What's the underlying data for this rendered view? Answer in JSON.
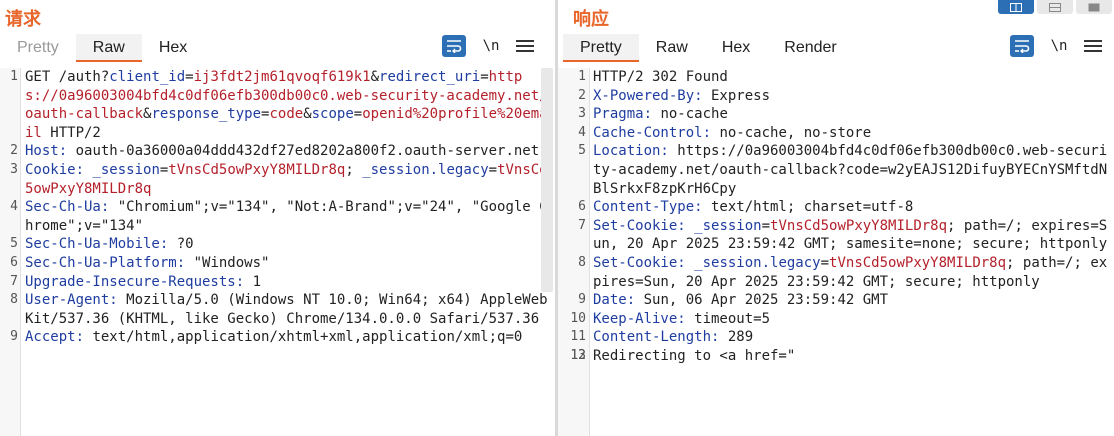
{
  "request": {
    "title": "请求",
    "tabs": [
      {
        "label": "Pretty",
        "state": "dim"
      },
      {
        "label": "Raw",
        "state": "active"
      },
      {
        "label": "Hex",
        "state": ""
      }
    ],
    "tools": {
      "wrap_icon": "word-wrap-icon",
      "newline_label": "\\n",
      "menu_icon": "hamburger-menu-icon"
    },
    "lines": [
      {
        "n": "1",
        "parts": [
          [
            "t",
            "GET /auth?"
          ],
          [
            "k",
            "client_id"
          ],
          [
            "t",
            "="
          ],
          [
            "v",
            "ij3fdt2jm61qvoqf619k1"
          ],
          [
            "t",
            "&"
          ],
          [
            "k",
            "redirect_uri"
          ],
          [
            "t",
            "="
          ],
          [
            "v",
            "https://0a96003004bfd4c0df06efb300db00c0.web-security-academy.net/oauth-callback"
          ],
          [
            "t",
            "&"
          ],
          [
            "k",
            "response_type"
          ],
          [
            "t",
            "="
          ],
          [
            "v",
            "code"
          ],
          [
            "t",
            "&"
          ],
          [
            "k",
            "scope"
          ],
          [
            "t",
            "="
          ],
          [
            "v",
            "openid%20profile%20email"
          ],
          [
            "t",
            " HTTP/2"
          ]
        ]
      },
      {
        "n": "2",
        "parts": [
          [
            "k",
            "Host:"
          ],
          [
            "t",
            " oauth-0a36000a04ddd432df27ed8202a800f2.oauth-server.net"
          ]
        ]
      },
      {
        "n": "3",
        "parts": [
          [
            "k",
            "Cookie:"
          ],
          [
            "t",
            " "
          ],
          [
            "k",
            "_session"
          ],
          [
            "t",
            "="
          ],
          [
            "v",
            "tVnsCd5owPxyY8MILDr8q"
          ],
          [
            "t",
            "; "
          ],
          [
            "k",
            "_session.legacy"
          ],
          [
            "t",
            "="
          ],
          [
            "v",
            "tVnsCd5owPxyY8MILDr8q"
          ]
        ]
      },
      {
        "n": "4",
        "parts": [
          [
            "k",
            "Sec-Ch-Ua:"
          ],
          [
            "t",
            " \"Chromium\";v=\"134\", \"Not:A-Brand\";v=\"24\", \"Google Chrome\";v=\"134\""
          ]
        ]
      },
      {
        "n": "5",
        "parts": [
          [
            "k",
            "Sec-Ch-Ua-Mobile:"
          ],
          [
            "t",
            " ?0"
          ]
        ]
      },
      {
        "n": "6",
        "parts": [
          [
            "k",
            "Sec-Ch-Ua-Platform:"
          ],
          [
            "t",
            " \"Windows\""
          ]
        ]
      },
      {
        "n": "7",
        "parts": [
          [
            "k",
            "Upgrade-Insecure-Requests:"
          ],
          [
            "t",
            " 1"
          ]
        ]
      },
      {
        "n": "8",
        "parts": [
          [
            "k",
            "User-Agent:"
          ],
          [
            "t",
            " Mozilla/5.0 (Windows NT 10.0; Win64; x64) AppleWebKit/537.36 (KHTML, like Gecko) Chrome/134.0.0.0 Safari/537.36"
          ]
        ]
      },
      {
        "n": "9",
        "parts": [
          [
            "k",
            "Accept:"
          ],
          [
            "t",
            " text/html,application/xhtml+xml,application/xml;q=0"
          ]
        ]
      }
    ]
  },
  "response": {
    "title": "响应",
    "tabs": [
      {
        "label": "Pretty",
        "state": "active"
      },
      {
        "label": "Raw",
        "state": ""
      },
      {
        "label": "Hex",
        "state": ""
      },
      {
        "label": "Render",
        "state": ""
      }
    ],
    "tools": {
      "wrap_icon": "word-wrap-icon",
      "newline_label": "\\n",
      "menu_icon": "hamburger-menu-icon"
    },
    "view_toggle_icons": [
      "split-horizontal-icon",
      "split-vertical-icon",
      "single-pane-icon"
    ],
    "lines": [
      {
        "n": "1",
        "parts": [
          [
            "t",
            "HTTP/2 302 Found"
          ]
        ]
      },
      {
        "n": "2",
        "parts": [
          [
            "k",
            "X-Powered-By:"
          ],
          [
            "t",
            " Express"
          ]
        ]
      },
      {
        "n": "3",
        "parts": [
          [
            "k",
            "Pragma:"
          ],
          [
            "t",
            " no-cache"
          ]
        ]
      },
      {
        "n": "4",
        "parts": [
          [
            "k",
            "Cache-Control:"
          ],
          [
            "t",
            " no-cache, no-store"
          ]
        ]
      },
      {
        "n": "5",
        "parts": [
          [
            "k",
            "Location:"
          ],
          [
            "t",
            " https://0a96003004bfd4c0df06efb300db00c0.web-security-academy.net/oauth-callback?code=w2yEAJS12DifuyBYECnYSMftdNBlSrkxF8zpKrH6Cpy"
          ]
        ]
      },
      {
        "n": "6",
        "parts": [
          [
            "k",
            "Content-Type:"
          ],
          [
            "t",
            " text/html; charset=utf-8"
          ]
        ]
      },
      {
        "n": "7",
        "parts": [
          [
            "k",
            "Set-Cookie:"
          ],
          [
            "t",
            " "
          ],
          [
            "k",
            "_session"
          ],
          [
            "t",
            "="
          ],
          [
            "v",
            "tVnsCd5owPxyY8MILDr8q"
          ],
          [
            "t",
            "; path=/; expires=Sun, 20 Apr 2025 23:59:42 GMT; samesite=none; secure; httponly"
          ]
        ]
      },
      {
        "n": "8",
        "parts": [
          [
            "k",
            "Set-Cookie:"
          ],
          [
            "t",
            " "
          ],
          [
            "k",
            "_session.legacy"
          ],
          [
            "t",
            "="
          ],
          [
            "v",
            "tVnsCd5owPxyY8MILDr8q"
          ],
          [
            "t",
            "; path=/; expires=Sun, 20 Apr 2025 23:59:42 GMT; secure; httponly"
          ]
        ]
      },
      {
        "n": "9",
        "parts": [
          [
            "k",
            "Date:"
          ],
          [
            "t",
            " Sun, 06 Apr 2025 23:59:42 GMT"
          ]
        ]
      },
      {
        "n": "10",
        "parts": [
          [
            "k",
            "Keep-Alive:"
          ],
          [
            "t",
            " timeout=5"
          ]
        ]
      },
      {
        "n": "11",
        "parts": [
          [
            "k",
            "Content-Length:"
          ],
          [
            "t",
            " 289"
          ]
        ]
      },
      {
        "n": "12",
        "parts": [
          [
            "t",
            ""
          ]
        ]
      },
      {
        "n": "13",
        "parts": [
          [
            "t",
            "Redirecting to <a href=\""
          ]
        ]
      }
    ]
  }
}
